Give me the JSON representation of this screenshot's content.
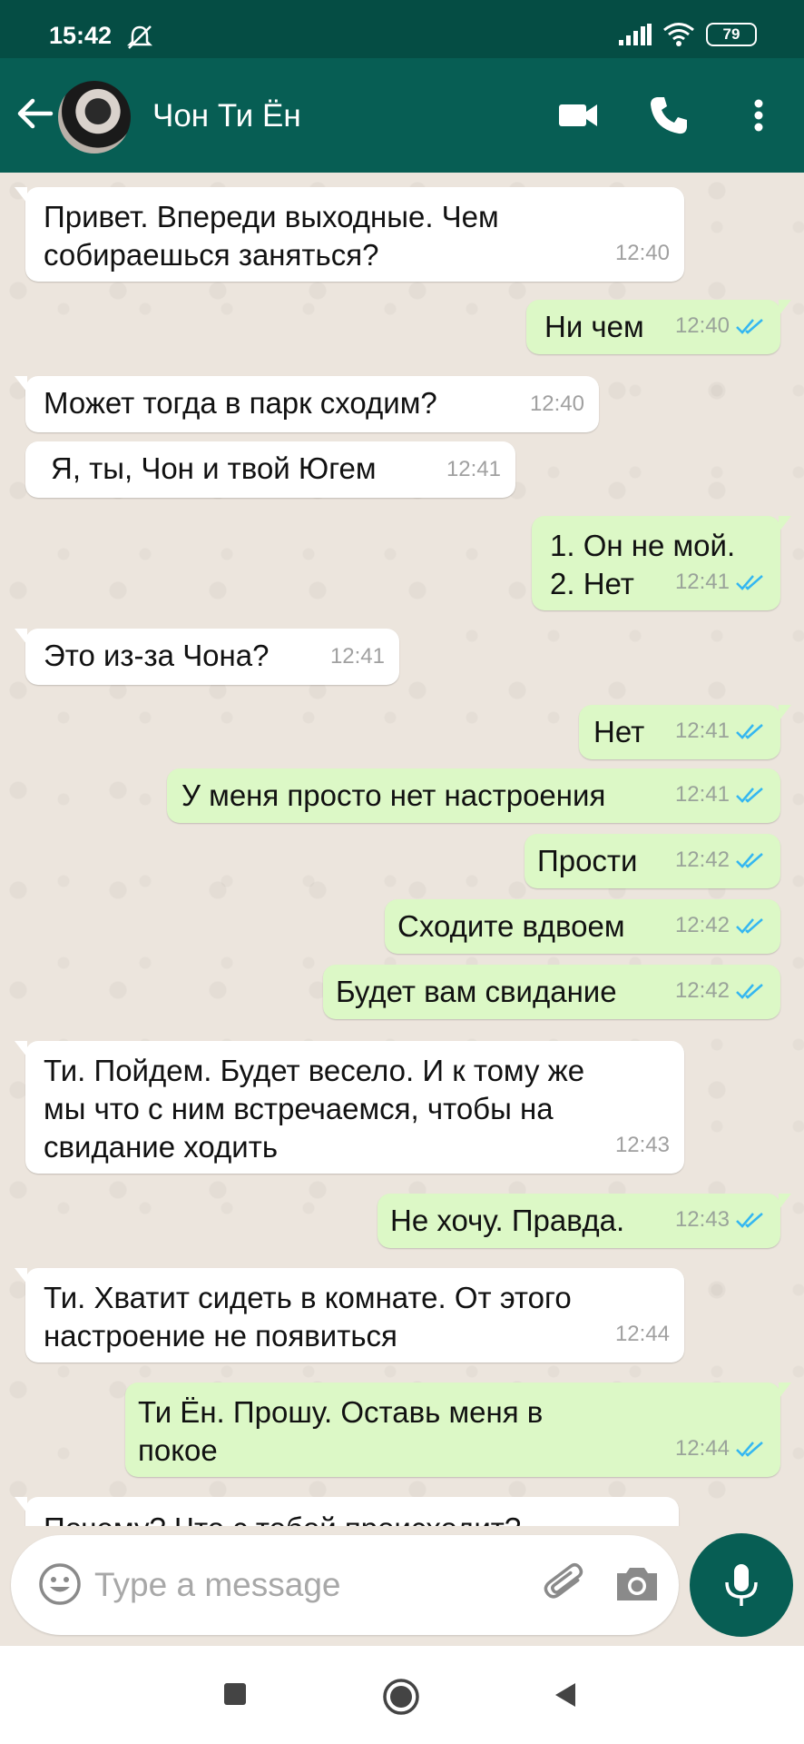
{
  "status_bar": {
    "time": "15:42",
    "battery": "79"
  },
  "header": {
    "contact_name": "Чон Ти Ён"
  },
  "messages": [
    {
      "text": "Привет. Впереди выходные. Чем\nсобираешься заняться?",
      "time": "12:40"
    },
    {
      "text": "Ни чем",
      "time": "12:40"
    },
    {
      "text": "Может тогда в парк сходим?",
      "time": "12:40"
    },
    {
      "text": "Я, ты, Чон и твой Югем",
      "time": "12:41"
    },
    {
      "text": "1. Он не мой.\n2. Нет",
      "time": "12:41"
    },
    {
      "text": "Это из-за Чона?",
      "time": "12:41"
    },
    {
      "text": "Нет",
      "time": "12:41"
    },
    {
      "text": "У меня просто нет настроения",
      "time": "12:41"
    },
    {
      "text": "Прости",
      "time": "12:42"
    },
    {
      "text": "Сходите вдвоем",
      "time": "12:42"
    },
    {
      "text": "Будет вам свидание",
      "time": "12:42"
    },
    {
      "text": "Ти. Пойдем. Будет весело. И к тому же\nмы что с ним встречаемся, чтобы на\nсвидание ходить",
      "time": "12:43"
    },
    {
      "text": "Не хочу. Правда.",
      "time": "12:43"
    },
    {
      "text": "Ти. Хватит сидеть в комнате. От этого\nнастроение не появиться",
      "time": "12:44"
    },
    {
      "text": "Ти Ён. Прошу. Оставь меня в\nпокое",
      "time": "12:44"
    },
    {
      "text": "Почему? Что с тобой происходит?",
      "time": ""
    }
  ],
  "composer": {
    "placeholder": "Type a message"
  },
  "colors": {
    "header": "#075e54",
    "status": "#054d44",
    "outgoing": "#dcf8c6",
    "incoming": "#ffffff",
    "ticks": "#34b7f1"
  }
}
